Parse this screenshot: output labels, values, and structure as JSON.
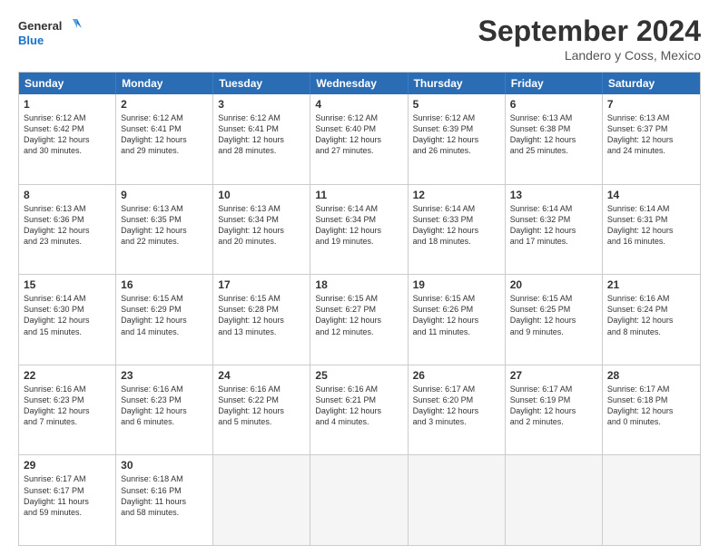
{
  "logo": {
    "line1": "General",
    "line2": "Blue"
  },
  "header": {
    "month_year": "September 2024",
    "location": "Landero y Coss, Mexico"
  },
  "weekdays": [
    "Sunday",
    "Monday",
    "Tuesday",
    "Wednesday",
    "Thursday",
    "Friday",
    "Saturday"
  ],
  "rows": [
    [
      {
        "day": "1",
        "text": "Sunrise: 6:12 AM\nSunset: 6:42 PM\nDaylight: 12 hours\nand 30 minutes."
      },
      {
        "day": "2",
        "text": "Sunrise: 6:12 AM\nSunset: 6:41 PM\nDaylight: 12 hours\nand 29 minutes."
      },
      {
        "day": "3",
        "text": "Sunrise: 6:12 AM\nSunset: 6:41 PM\nDaylight: 12 hours\nand 28 minutes."
      },
      {
        "day": "4",
        "text": "Sunrise: 6:12 AM\nSunset: 6:40 PM\nDaylight: 12 hours\nand 27 minutes."
      },
      {
        "day": "5",
        "text": "Sunrise: 6:12 AM\nSunset: 6:39 PM\nDaylight: 12 hours\nand 26 minutes."
      },
      {
        "day": "6",
        "text": "Sunrise: 6:13 AM\nSunset: 6:38 PM\nDaylight: 12 hours\nand 25 minutes."
      },
      {
        "day": "7",
        "text": "Sunrise: 6:13 AM\nSunset: 6:37 PM\nDaylight: 12 hours\nand 24 minutes."
      }
    ],
    [
      {
        "day": "8",
        "text": "Sunrise: 6:13 AM\nSunset: 6:36 PM\nDaylight: 12 hours\nand 23 minutes."
      },
      {
        "day": "9",
        "text": "Sunrise: 6:13 AM\nSunset: 6:35 PM\nDaylight: 12 hours\nand 22 minutes."
      },
      {
        "day": "10",
        "text": "Sunrise: 6:13 AM\nSunset: 6:34 PM\nDaylight: 12 hours\nand 20 minutes."
      },
      {
        "day": "11",
        "text": "Sunrise: 6:14 AM\nSunset: 6:34 PM\nDaylight: 12 hours\nand 19 minutes."
      },
      {
        "day": "12",
        "text": "Sunrise: 6:14 AM\nSunset: 6:33 PM\nDaylight: 12 hours\nand 18 minutes."
      },
      {
        "day": "13",
        "text": "Sunrise: 6:14 AM\nSunset: 6:32 PM\nDaylight: 12 hours\nand 17 minutes."
      },
      {
        "day": "14",
        "text": "Sunrise: 6:14 AM\nSunset: 6:31 PM\nDaylight: 12 hours\nand 16 minutes."
      }
    ],
    [
      {
        "day": "15",
        "text": "Sunrise: 6:14 AM\nSunset: 6:30 PM\nDaylight: 12 hours\nand 15 minutes."
      },
      {
        "day": "16",
        "text": "Sunrise: 6:15 AM\nSunset: 6:29 PM\nDaylight: 12 hours\nand 14 minutes."
      },
      {
        "day": "17",
        "text": "Sunrise: 6:15 AM\nSunset: 6:28 PM\nDaylight: 12 hours\nand 13 minutes."
      },
      {
        "day": "18",
        "text": "Sunrise: 6:15 AM\nSunset: 6:27 PM\nDaylight: 12 hours\nand 12 minutes."
      },
      {
        "day": "19",
        "text": "Sunrise: 6:15 AM\nSunset: 6:26 PM\nDaylight: 12 hours\nand 11 minutes."
      },
      {
        "day": "20",
        "text": "Sunrise: 6:15 AM\nSunset: 6:25 PM\nDaylight: 12 hours\nand 9 minutes."
      },
      {
        "day": "21",
        "text": "Sunrise: 6:16 AM\nSunset: 6:24 PM\nDaylight: 12 hours\nand 8 minutes."
      }
    ],
    [
      {
        "day": "22",
        "text": "Sunrise: 6:16 AM\nSunset: 6:23 PM\nDaylight: 12 hours\nand 7 minutes."
      },
      {
        "day": "23",
        "text": "Sunrise: 6:16 AM\nSunset: 6:23 PM\nDaylight: 12 hours\nand 6 minutes."
      },
      {
        "day": "24",
        "text": "Sunrise: 6:16 AM\nSunset: 6:22 PM\nDaylight: 12 hours\nand 5 minutes."
      },
      {
        "day": "25",
        "text": "Sunrise: 6:16 AM\nSunset: 6:21 PM\nDaylight: 12 hours\nand 4 minutes."
      },
      {
        "day": "26",
        "text": "Sunrise: 6:17 AM\nSunset: 6:20 PM\nDaylight: 12 hours\nand 3 minutes."
      },
      {
        "day": "27",
        "text": "Sunrise: 6:17 AM\nSunset: 6:19 PM\nDaylight: 12 hours\nand 2 minutes."
      },
      {
        "day": "28",
        "text": "Sunrise: 6:17 AM\nSunset: 6:18 PM\nDaylight: 12 hours\nand 0 minutes."
      }
    ],
    [
      {
        "day": "29",
        "text": "Sunrise: 6:17 AM\nSunset: 6:17 PM\nDaylight: 11 hours\nand 59 minutes."
      },
      {
        "day": "30",
        "text": "Sunrise: 6:18 AM\nSunset: 6:16 PM\nDaylight: 11 hours\nand 58 minutes."
      },
      {
        "day": "",
        "text": ""
      },
      {
        "day": "",
        "text": ""
      },
      {
        "day": "",
        "text": ""
      },
      {
        "day": "",
        "text": ""
      },
      {
        "day": "",
        "text": ""
      }
    ]
  ]
}
